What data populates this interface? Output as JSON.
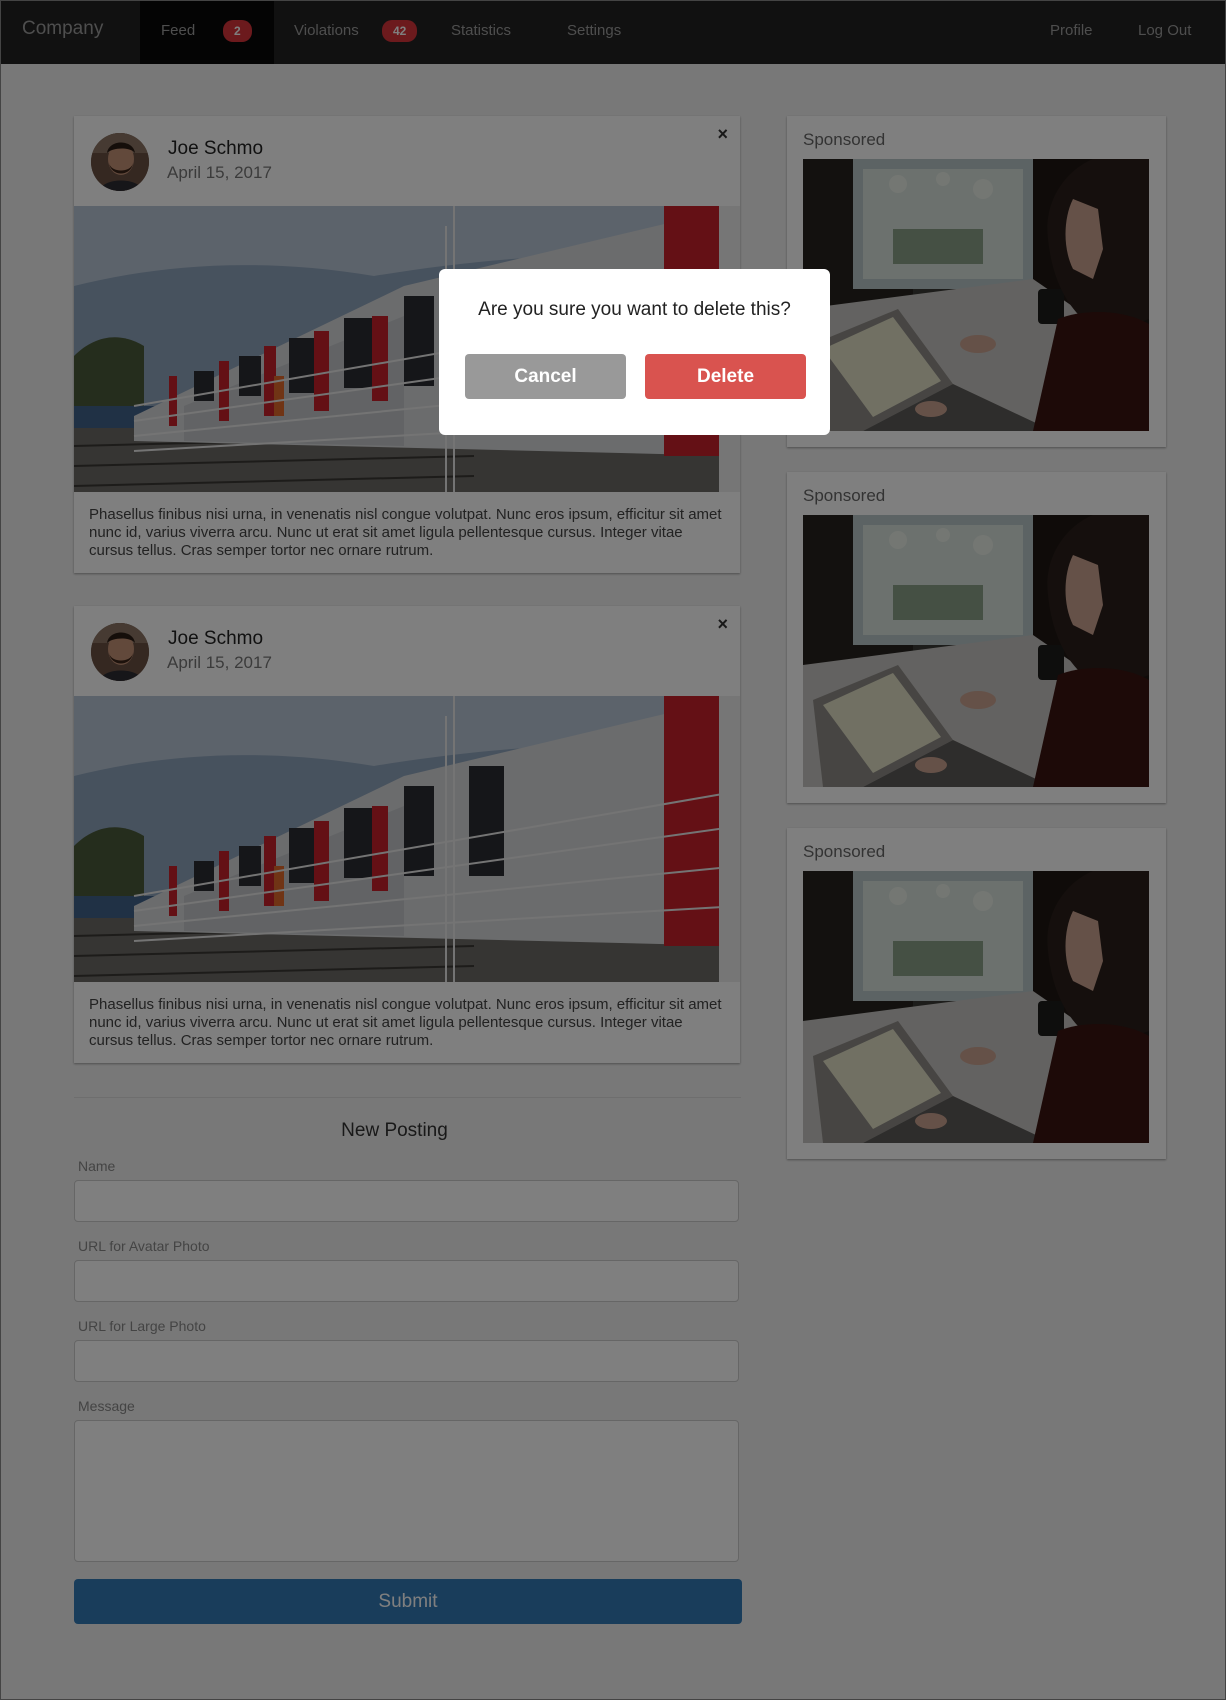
{
  "navbar": {
    "brand": "Company",
    "items": [
      {
        "label": "Feed",
        "badge": "2"
      },
      {
        "label": "Violations",
        "badge": "42"
      },
      {
        "label": "Statistics"
      },
      {
        "label": "Settings"
      }
    ],
    "right_items": [
      {
        "label": "Profile"
      },
      {
        "label": "Log Out"
      }
    ]
  },
  "posts": [
    {
      "author": "Joe Schmo",
      "date": "April 15, 2017",
      "close_label": "×",
      "text": "Phasellus finibus nisi urna, in venenatis nisl congue volutpat. Nunc eros ipsum, efficitur sit amet nunc id, varius viverra arcu. Nunc ut erat sit amet ligula pellentesque cursus. Integer vitae cursus tellus. Cras semper tortor nec ornare rutrum."
    },
    {
      "author": "Joe Schmo",
      "date": "April 15, 2017",
      "close_label": "×",
      "text": "Phasellus finibus nisi urna, in venenatis nisl congue volutpat. Nunc eros ipsum, efficitur sit amet nunc id, varius viverra arcu. Nunc ut erat sit amet ligula pellentesque cursus. Integer vitae cursus tellus. Cras semper tortor nec ornare rutrum."
    }
  ],
  "sidebar": {
    "sponsored": [
      {
        "label": "Sponsored"
      },
      {
        "label": "Sponsored"
      },
      {
        "label": "Sponsored"
      }
    ]
  },
  "form": {
    "title": "New Posting",
    "name_label": "Name",
    "avatar_label": "URL for Avatar Photo",
    "large_photo_label": "URL for Large Photo",
    "message_label": "Message",
    "submit_label": "Submit"
  },
  "modal": {
    "message": "Are you sure you want to delete this?",
    "cancel_label": "Cancel",
    "delete_label": "Delete"
  },
  "colors": {
    "navbar": "#222222",
    "badge": "#d9353b",
    "delete": "#d9534f",
    "cancel": "#999999",
    "submit": "#337ab7"
  }
}
